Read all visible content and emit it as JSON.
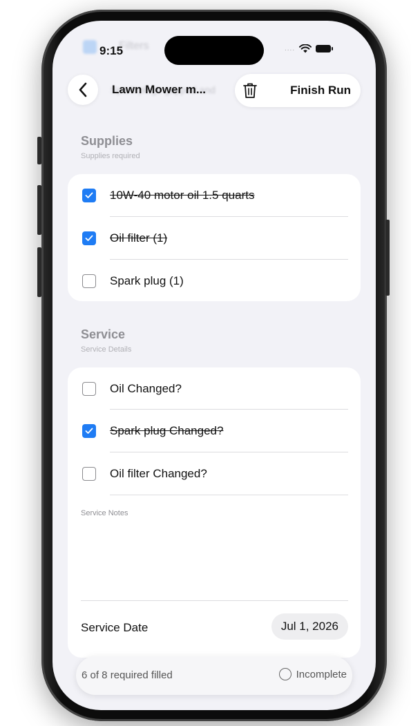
{
  "status_bar": {
    "time": "9:15",
    "signal": "...."
  },
  "ghost_content": {
    "top_item": "Filters",
    "nav_item": "Spark plugs gapped and"
  },
  "nav": {
    "title": "Lawn Mower m...",
    "finish_label": "Finish Run"
  },
  "supplies": {
    "title": "Supplies",
    "subtitle": "Supplies required",
    "items": [
      {
        "label": "10W-40 motor oil 1.5 quarts",
        "checked": true
      },
      {
        "label": "Oil filter (1)",
        "checked": true
      },
      {
        "label": "Spark plug (1)",
        "checked": false
      }
    ]
  },
  "service": {
    "title": "Service",
    "subtitle": "Service Details",
    "items": [
      {
        "label": "Oil Changed?",
        "checked": false
      },
      {
        "label": "Spark plug Changed?",
        "checked": true
      },
      {
        "label": "Oil filter Changed?",
        "checked": false
      }
    ],
    "notes_label": "Service Notes",
    "date_label": "Service Date",
    "date_value": "Jul 1, 2026"
  },
  "footer": {
    "progress_text": "6 of 8 required filled",
    "status": "Incomplete"
  },
  "colors": {
    "accent": "#1f7cf4",
    "background": "#f2f2f7"
  }
}
